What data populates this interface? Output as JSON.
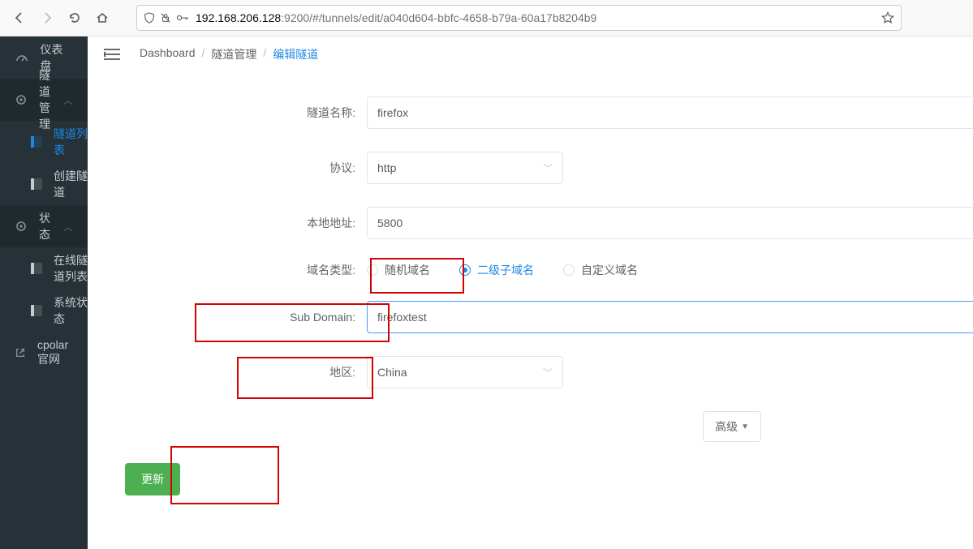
{
  "browser": {
    "url_host": "192.168.206.128",
    "url_rest": ":9200/#/tunnels/edit/a040d604-bbfc-4658-b79a-60a17b8204b9"
  },
  "sidebar": {
    "dashboard": "仪表盘",
    "tunnel_mgmt": "隧道管理",
    "tunnel_list": "隧道列表",
    "create_tunnel": "创建隧道",
    "status": "状态",
    "online_list": "在线隧道列表",
    "sys_status": "系统状态",
    "cpolar": "cpolar官网"
  },
  "crumbs": {
    "a": "Dashboard",
    "b": "隧道管理",
    "c": "编辑隧道"
  },
  "form": {
    "name_label": "隧道名称:",
    "name_value": "firefox",
    "proto_label": "协议:",
    "proto_value": "http",
    "addr_label": "本地地址:",
    "addr_value": "5800",
    "domain_type_label": "域名类型:",
    "domain_types": {
      "rand": "随机域名",
      "sub": "二级子域名",
      "custom": "自定义域名"
    },
    "subdomain_label": "Sub Domain:",
    "subdomain_value": "firefoxtest",
    "region_label": "地区:",
    "region_value": "China",
    "adv": "高级",
    "submit": "更新"
  }
}
